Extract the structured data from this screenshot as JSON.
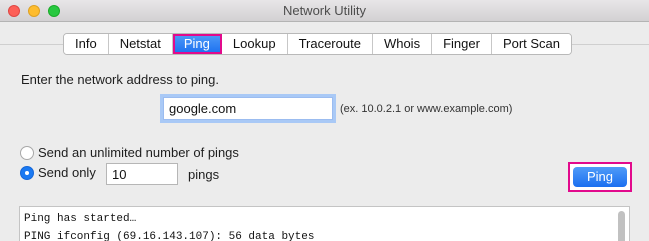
{
  "window": {
    "title": "Network Utility"
  },
  "tabs": [
    {
      "label": "Info"
    },
    {
      "label": "Netstat"
    },
    {
      "label": "Ping"
    },
    {
      "label": "Lookup"
    },
    {
      "label": "Traceroute"
    },
    {
      "label": "Whois"
    },
    {
      "label": "Finger"
    },
    {
      "label": "Port Scan"
    }
  ],
  "active_tab": "Ping",
  "ping": {
    "prompt": "Enter the network address to ping.",
    "address_value": "google.com",
    "address_hint": "(ex. 10.0.2.1 or www.example.com)",
    "option_unlimited": "Send an unlimited number of pings",
    "option_send_only": "Send only",
    "count_value": "10",
    "count_suffix": "pings",
    "selected_option": "send_only",
    "button_label": "Ping"
  },
  "output": {
    "lines": [
      "Ping has started…",
      "PING ifconfig (69.16.143.107): 56 data bytes"
    ]
  },
  "colors": {
    "accent": "#1a6ff0",
    "highlight": "#e20a8c"
  }
}
